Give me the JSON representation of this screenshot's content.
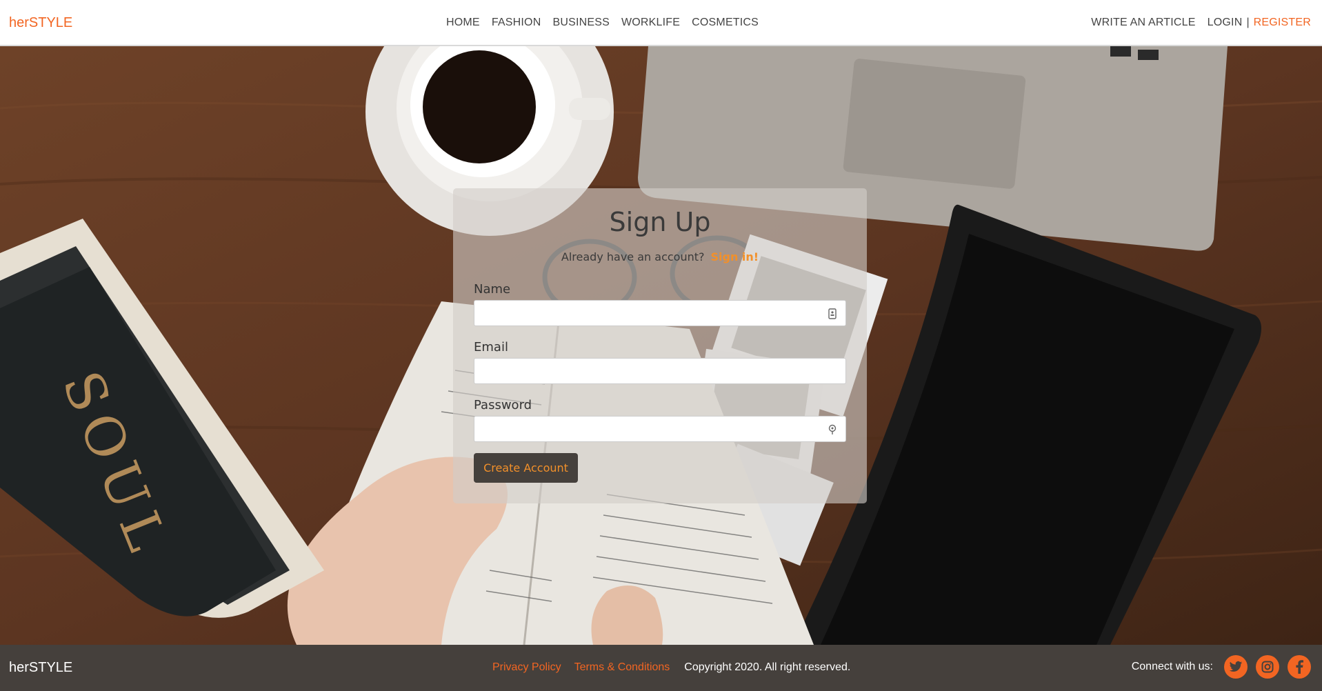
{
  "header": {
    "logo": "herSTYLE",
    "nav": [
      "HOME",
      "FASHION",
      "BUSINESS",
      "WORKLIFE",
      "COSMETICS"
    ],
    "write_article": "WRITE AN ARTICLE",
    "login": "LOGIN",
    "separator": "|",
    "register": "REGISTER"
  },
  "hero": {
    "book_text": "SOUL"
  },
  "signup": {
    "title": "Sign Up",
    "already_text": "Already have an account?",
    "signin_link": "Sign in!",
    "name_label": "Name",
    "name_value": "",
    "email_label": "Email",
    "email_value": "",
    "password_label": "Password",
    "password_value": "",
    "submit_label": "Create Account"
  },
  "footer": {
    "logo": "herSTYLE",
    "privacy": "Privacy Policy",
    "terms": "Terms & Conditions",
    "copyright": "Copyright 2020. All right reserved.",
    "connect": "Connect with us:",
    "social_icons": [
      "twitter-icon",
      "instagram-icon",
      "facebook-icon"
    ]
  },
  "colors": {
    "accent": "#f26522",
    "accent_link": "#f2902a",
    "footer_bg": "#45403c"
  }
}
